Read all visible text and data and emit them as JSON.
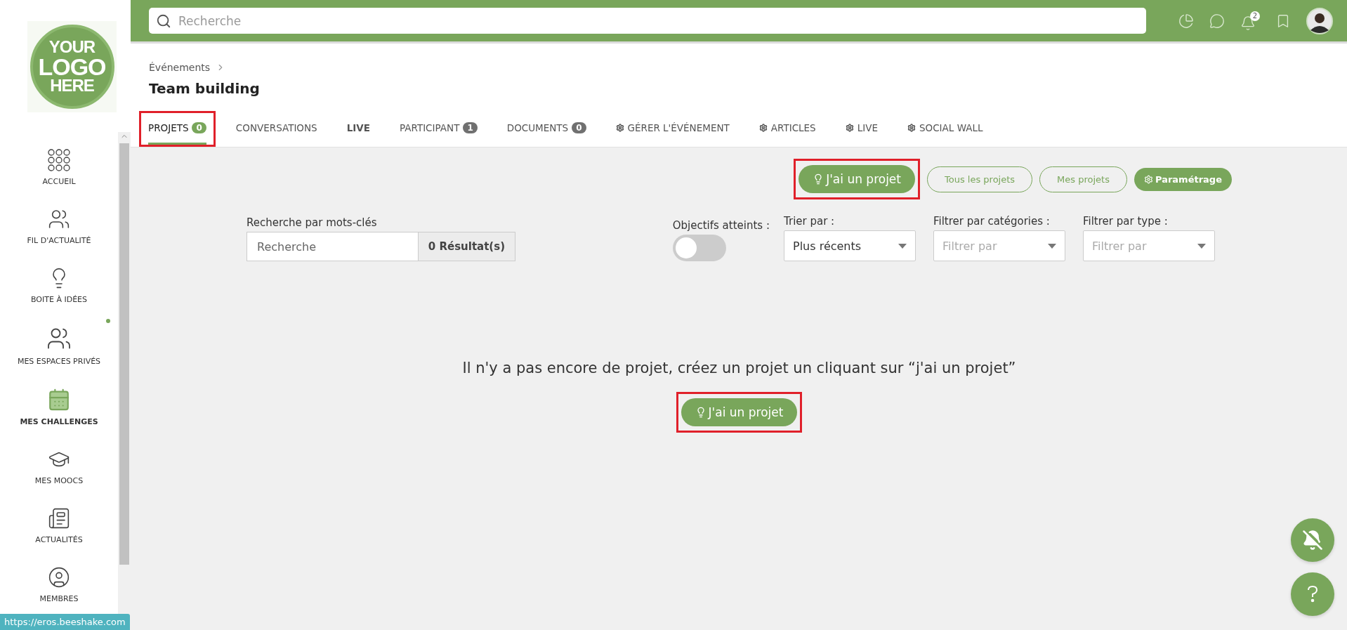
{
  "logo": {
    "lines": [
      "YOUR",
      "LOGO",
      "HERE"
    ]
  },
  "sidebar": {
    "items": [
      {
        "label": "ACCUEIL",
        "selected": false,
        "dot": false
      },
      {
        "label": "FIL D'ACTUALITÉ",
        "selected": false,
        "dot": false
      },
      {
        "label": "BOITE À IDÉES",
        "selected": false,
        "dot": false
      },
      {
        "label": "MES ESPACES PRIVÉS",
        "selected": false,
        "dot": true
      },
      {
        "label": "MES CHALLENGES",
        "selected": true,
        "dot": false
      },
      {
        "label": "MES MOOCS",
        "selected": false,
        "dot": false
      },
      {
        "label": "ACTUALITÉS",
        "selected": false,
        "dot": false
      },
      {
        "label": "MEMBRES",
        "selected": false,
        "dot": false
      }
    ]
  },
  "topbar": {
    "search": {
      "placeholder": "Recherche"
    },
    "notifications_count": "2"
  },
  "breadcrumb": [
    "Événements"
  ],
  "title": "Team building",
  "tabs": [
    {
      "label": "PROJETS",
      "count": "0",
      "kind": "plain",
      "selected": true,
      "emphasized": false,
      "highlighted": true
    },
    {
      "label": "CONVERSATIONS",
      "kind": "plain",
      "selected": false,
      "emphasized": false,
      "highlighted": false
    },
    {
      "label": "LIVE",
      "kind": "plain",
      "selected": false,
      "emphasized": true,
      "highlighted": false
    },
    {
      "label": "PARTICIPANT",
      "count": "1",
      "kind": "plain",
      "selected": false,
      "emphasized": false,
      "highlighted": false
    },
    {
      "label": "DOCUMENTS",
      "count": "0",
      "kind": "plain",
      "selected": false,
      "emphasized": false,
      "highlighted": false
    },
    {
      "label": "GÉRER L'ÉVÉNEMENT",
      "kind": "settings",
      "selected": false,
      "emphasized": false,
      "highlighted": false
    },
    {
      "label": "ARTICLES",
      "kind": "settings",
      "selected": false,
      "emphasized": false,
      "highlighted": false
    },
    {
      "label": "LIVE",
      "kind": "settings",
      "selected": false,
      "emphasized": false,
      "highlighted": false
    },
    {
      "label": "SOCIAL WALL",
      "kind": "settings",
      "selected": false,
      "emphasized": false,
      "highlighted": false
    }
  ],
  "actions": [
    {
      "label": "J'ai un projet",
      "kind": "primary",
      "highlighted": true
    },
    {
      "label": "Tous les projets",
      "kind": "outline",
      "highlighted": false
    },
    {
      "label": "Mes projets",
      "kind": "outline",
      "highlighted": false
    },
    {
      "label": "Paramétrage",
      "kind": "settings",
      "highlighted": false
    }
  ],
  "keyword_search": {
    "label": "Recherche par mots-clés",
    "placeholder": "Recherche",
    "results": "0 Résultat(s)"
  },
  "goals_toggle": {
    "label": "Objectifs atteints :",
    "on": false
  },
  "filters": [
    {
      "label": "Trier par :",
      "value": "Plus récents"
    },
    {
      "label": "Filtrer par catégories :",
      "placeholder": "Filtrer par"
    },
    {
      "label": "Filtrer par type :",
      "placeholder": "Filtrer par"
    }
  ],
  "empty_state": {
    "message": "Il n'y a pas encore de projet, créez un projet un cliquant sur “j'ai un projet”",
    "button": {
      "label": "J'ai un projet",
      "highlighted": true
    }
  },
  "status_url": "https://eros.beeshake.com"
}
